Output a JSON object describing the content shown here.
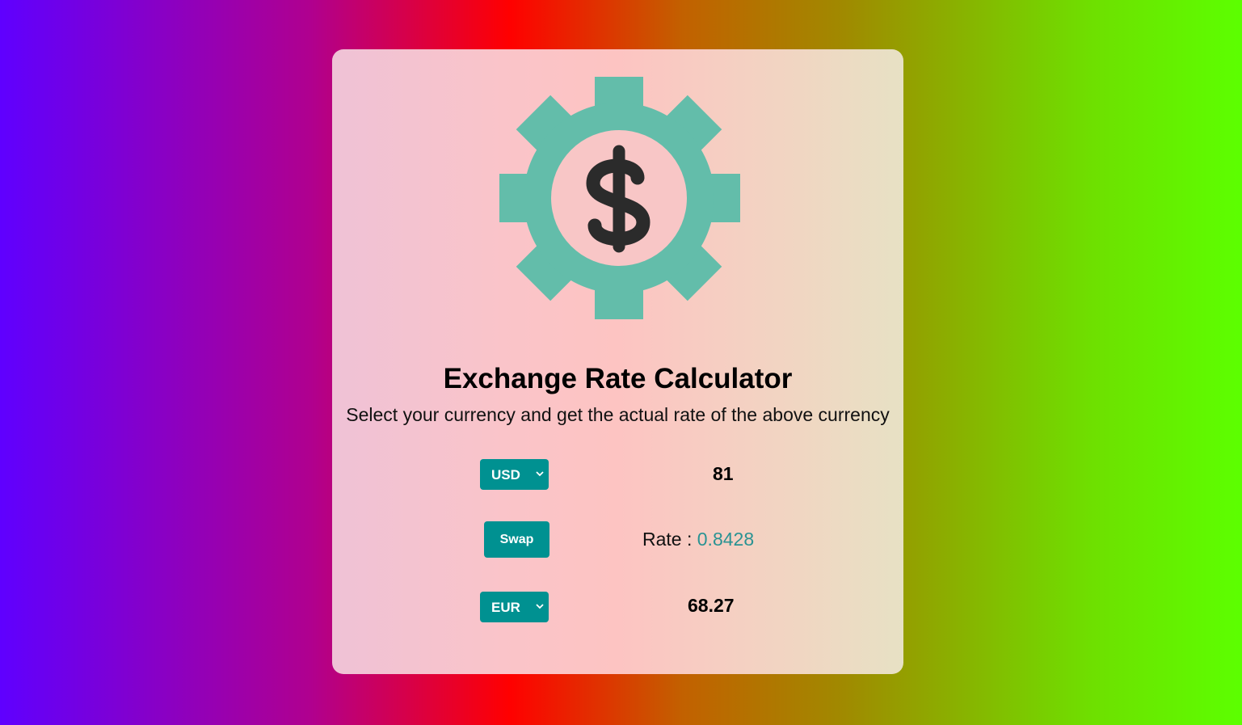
{
  "app": {
    "title": "Exchange Rate Calculator",
    "subtitle": "Select your currency and get the actual rate of the above currency",
    "logo_icon": "dollar-gear-icon"
  },
  "currency_one": {
    "selected": "USD",
    "amount": "81"
  },
  "swap": {
    "label": "Swap"
  },
  "rate": {
    "label": "Rate : ",
    "value": "0.8428"
  },
  "currency_two": {
    "selected": "EUR",
    "amount": "68.27"
  },
  "colors": {
    "accent": "#009191",
    "gear": "#63bdaa",
    "dollar": "#2b2b2b",
    "rate_value": "#2a9393"
  }
}
